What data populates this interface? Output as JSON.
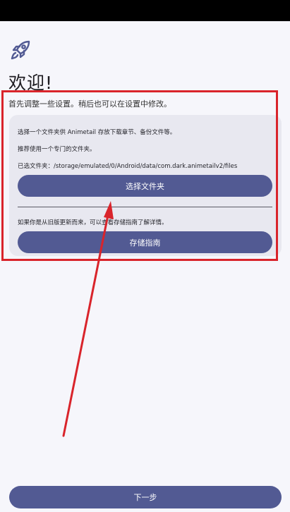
{
  "welcome": {
    "title": "欢迎!",
    "subtitle": "首先调整一些设置。稍后也可以在设置中修改。"
  },
  "storage": {
    "desc1": "选择一个文件夹供 Animetail 存放下载章节、备份文件等。",
    "desc2": "推荐使用一个专门的文件夹。",
    "selected": "已选文件夹：/storage/emulated/0/Android/data/com.dark.animetailv2/files",
    "select_button": "选择文件夹",
    "update_hint": "如果你是从旧版更新而来，可以查看存储指南了解详情。",
    "guide_button": "存储指南"
  },
  "footer": {
    "next_button": "下一步"
  },
  "icons": {
    "rocket": "rocket-icon"
  },
  "colors": {
    "accent": "#525a93",
    "card": "#e8e8f0",
    "annotation": "#d9242b"
  }
}
